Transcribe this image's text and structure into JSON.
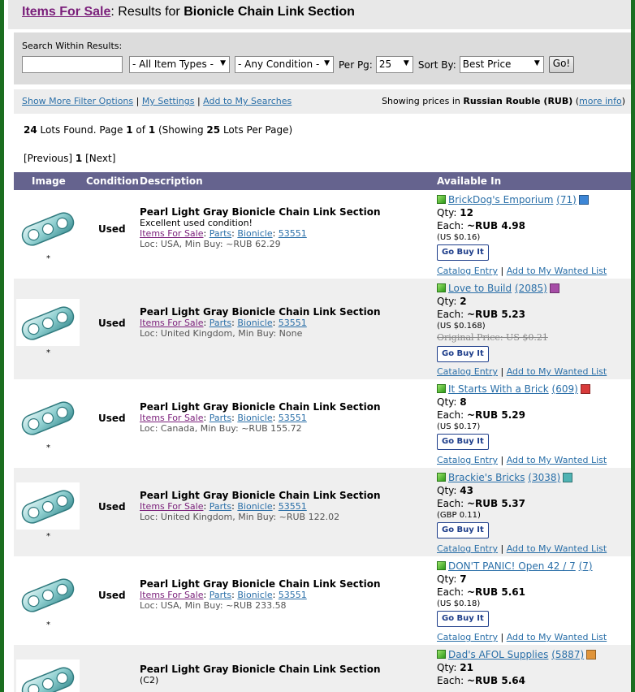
{
  "header": {
    "link": "Items For Sale",
    "sep": ": Results for ",
    "query": "Bionicle Chain Link Section"
  },
  "filters": {
    "search_label": "Search Within Results:",
    "search_value": "",
    "item_types": "- All Item Types -",
    "condition": "- Any Condition -",
    "perpage_label": "Per Pg:",
    "perpage": "25",
    "sortby_label": "Sort By:",
    "sortby": "Best Price",
    "go": "Go!"
  },
  "links": {
    "more_filters": "Show More Filter Options",
    "settings": "My Settings",
    "add_search": "Add to My Searches",
    "showing_prefix": "Showing prices in",
    "currency": "Russian Rouble (RUB)",
    "more_info": "more info"
  },
  "summary": {
    "lots": "24",
    "t1": " Lots Found. Page ",
    "page": "1",
    "t2": " of ",
    "pages": "1",
    "t3": " (Showing ",
    "perpage": "25",
    "t4": " Lots Per Page)"
  },
  "pager": {
    "prev": "[Previous]",
    "current": "1",
    "next": "[Next]"
  },
  "columns": {
    "image": "Image",
    "condition": "Condition",
    "description": "Description",
    "available": "Available In"
  },
  "colors": {
    "border": "#1b6e20",
    "header_bg": "#65638e",
    "link": "#2a6fa8",
    "ifs_link": "#7a1f7a"
  },
  "rows": [
    {
      "star": "*",
      "condition": "Used",
      "title": "Pearl Light Gray Bionicle Chain Link Section",
      "note": "Excellent used condition!",
      "crumb1": "Items For Sale",
      "crumb2": "Parts",
      "crumb3": "Bionicle",
      "crumb4": "53551",
      "loc": "Loc: USA, Min Buy: ~RUB 62.29",
      "store": "BrickDog's Emporium",
      "feedback": "(71)",
      "cube_color": "#3d86d6",
      "qty_label": "Qty: ",
      "qty": "12",
      "each_label": "Each: ",
      "price": "~RUB 4.98",
      "orig_curr": "(US $0.16)",
      "orig_price": "",
      "buy": "Go Buy It",
      "catalog": "Catalog Entry",
      "wanted": "Add to My Wanted List"
    },
    {
      "star": "*",
      "condition": "Used",
      "title": "Pearl Light Gray Bionicle Chain Link Section",
      "note": "",
      "crumb1": "Items For Sale",
      "crumb2": "Parts",
      "crumb3": "Bionicle",
      "crumb4": "53551",
      "loc": "Loc: United Kingdom, Min Buy: None",
      "store": "Love to Build",
      "feedback": "(2085)",
      "cube_color": "#a64ca6",
      "qty_label": "Qty: ",
      "qty": "2",
      "each_label": "Each: ",
      "price": "~RUB 5.23",
      "orig_curr": "(US $0.168)",
      "orig_price": "Original Price: US $0.21",
      "buy": "Go Buy It",
      "catalog": "Catalog Entry",
      "wanted": "Add to My Wanted List"
    },
    {
      "star": "*",
      "condition": "Used",
      "title": "Pearl Light Gray Bionicle Chain Link Section",
      "note": "",
      "crumb1": "Items For Sale",
      "crumb2": "Parts",
      "crumb3": "Bionicle",
      "crumb4": "53551",
      "loc": "Loc: Canada, Min Buy: ~RUB 155.72",
      "store": "It Starts With a Brick",
      "feedback": "(609)",
      "cube_color": "#d83a3a",
      "qty_label": "Qty: ",
      "qty": "8",
      "each_label": "Each: ",
      "price": "~RUB 5.29",
      "orig_curr": "(US $0.17)",
      "orig_price": "",
      "buy": "Go Buy It",
      "catalog": "Catalog Entry",
      "wanted": "Add to My Wanted List"
    },
    {
      "star": "*",
      "condition": "Used",
      "title": "Pearl Light Gray Bionicle Chain Link Section",
      "note": "",
      "crumb1": "Items For Sale",
      "crumb2": "Parts",
      "crumb3": "Bionicle",
      "crumb4": "53551",
      "loc": "Loc: United Kingdom, Min Buy: ~RUB 122.02",
      "store": "Brackie's Bricks",
      "feedback": "(3038)",
      "cube_color": "#4fb3b3",
      "qty_label": "Qty: ",
      "qty": "43",
      "each_label": "Each: ",
      "price": "~RUB 5.37",
      "orig_curr": "(GBP 0.11)",
      "orig_price": "",
      "buy": "Go Buy It",
      "catalog": "Catalog Entry",
      "wanted": "Add to My Wanted List"
    },
    {
      "star": "*",
      "condition": "Used",
      "title": "Pearl Light Gray Bionicle Chain Link Section",
      "note": "",
      "crumb1": "Items For Sale",
      "crumb2": "Parts",
      "crumb3": "Bionicle",
      "crumb4": "53551",
      "loc": "Loc: USA, Min Buy: ~RUB 233.58",
      "store": "DON'T PANIC! Open 42 / 7",
      "feedback": "(7)",
      "cube_color": "",
      "qty_label": "Qty: ",
      "qty": "7",
      "each_label": "Each: ",
      "price": "~RUB 5.61",
      "orig_curr": "(US $0.18)",
      "orig_price": "",
      "buy": "Go Buy It",
      "catalog": "Catalog Entry",
      "wanted": "Add to My Wanted List"
    },
    {
      "star": "",
      "condition": "",
      "title": "Pearl Light Gray Bionicle Chain Link Section",
      "note": "(C2)",
      "crumb1": "",
      "crumb2": "",
      "crumb3": "",
      "crumb4": "",
      "loc": "",
      "store": "Dad's AFOL Supplies",
      "feedback": "(5887)",
      "cube_color": "#e0943a",
      "qty_label": "Qty: ",
      "qty": "21",
      "each_label": "Each: ",
      "price": "~RUB 5.64",
      "orig_curr": "",
      "orig_price": "",
      "buy": "",
      "catalog": "",
      "wanted": ""
    }
  ]
}
